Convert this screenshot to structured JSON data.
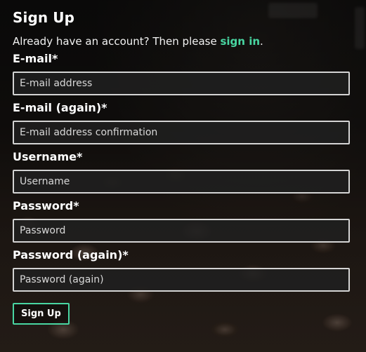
{
  "page": {
    "title": "Sign Up",
    "subtitle_prefix": "Already have an account? Then please ",
    "subtitle_link": "sign in",
    "subtitle_suffix": "."
  },
  "fields": [
    {
      "label": "E-mail*",
      "placeholder": "E-mail address",
      "value": ""
    },
    {
      "label": "E-mail (again)*",
      "placeholder": "E-mail address confirmation",
      "value": ""
    },
    {
      "label": "Username*",
      "placeholder": "Username",
      "value": ""
    },
    {
      "label": "Password*",
      "placeholder": "Password",
      "value": ""
    },
    {
      "label": "Password (again)*",
      "placeholder": "Password (again)",
      "value": ""
    }
  ],
  "actions": {
    "signup_label": "Sign Up"
  },
  "colors": {
    "accent": "#49d6a2",
    "text": "#ffffff",
    "input_border": "#d4d4d4"
  }
}
